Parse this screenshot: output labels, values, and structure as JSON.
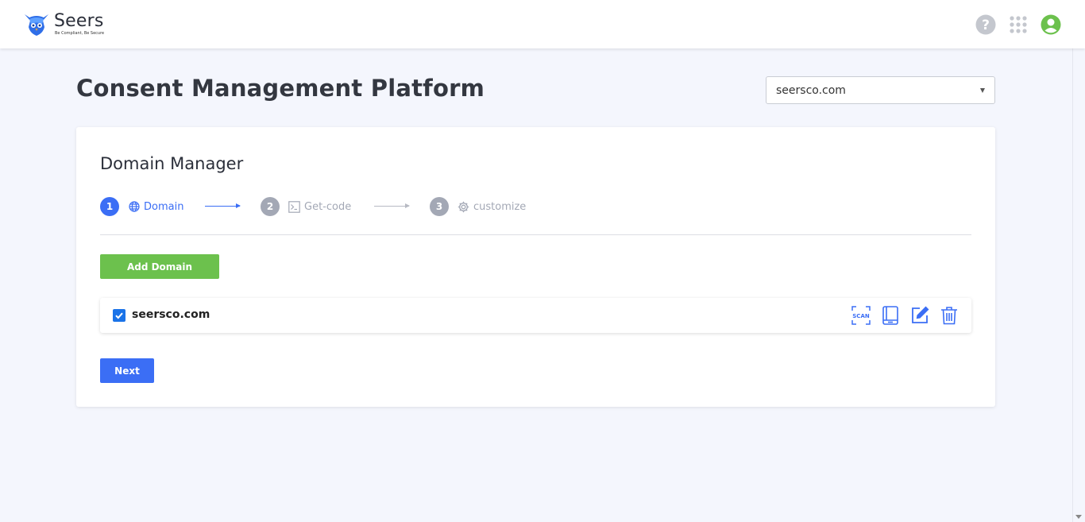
{
  "brand": {
    "name": "Seers",
    "tagline": "Be Compliant, Be Secure",
    "logo_icon": "seers-owl-logo"
  },
  "topbar": {
    "icons": [
      "help-icon",
      "apps-grid-icon",
      "user-account-icon"
    ],
    "icon_color": "#bfc2c9",
    "account_color": "#6cc14d"
  },
  "page": {
    "title": "Consent Management Platform",
    "domain_select": {
      "value": "seersco.com"
    }
  },
  "card": {
    "title": "Domain Manager",
    "steps": [
      {
        "number": "1",
        "label": "Domain",
        "icon": "globe-icon",
        "state": "active"
      },
      {
        "number": "2",
        "label": "Get-code",
        "icon": "terminal-icon",
        "state": "inactive"
      },
      {
        "number": "3",
        "label": "customize",
        "icon": "gear-icon",
        "state": "inactive"
      }
    ],
    "add_domain_label": "Add Domain",
    "domains": [
      {
        "name": "seersco.com",
        "checked": true,
        "actions": [
          {
            "name": "scan-icon",
            "text": "SCAN"
          },
          {
            "name": "book-icon"
          },
          {
            "name": "edit-icon"
          },
          {
            "name": "trash-icon"
          }
        ]
      }
    ],
    "next_label": "Next"
  },
  "colors": {
    "primary": "#3b6ef5",
    "success": "#6cc14d",
    "muted": "#a3a8b5",
    "background": "#f4f6fd"
  }
}
